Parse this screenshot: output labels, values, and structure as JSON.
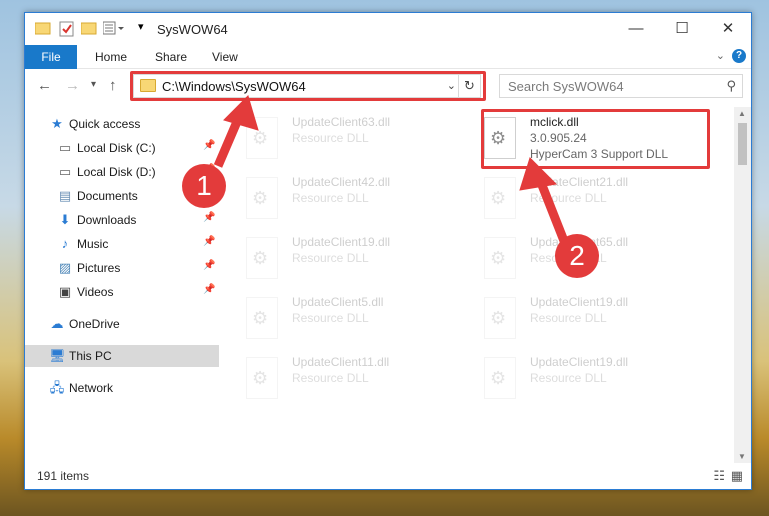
{
  "window": {
    "title": "SysWOW64",
    "controls": {
      "minimize": "—",
      "maximize": "☐",
      "close": "✕"
    }
  },
  "ribbon": {
    "tabs": [
      "File",
      "Home",
      "Share",
      "View"
    ],
    "help": "?"
  },
  "address": {
    "path": "C:\\Windows\\SysWOW64",
    "search_placeholder": "Search SysWOW64"
  },
  "sidebar": {
    "items": [
      {
        "label": "Quick access",
        "icon": "star-icon",
        "pinned": false
      },
      {
        "label": "Local Disk (C:)",
        "icon": "drive-icon",
        "pinned": true
      },
      {
        "label": "Local Disk (D:)",
        "icon": "drive-icon",
        "pinned": true
      },
      {
        "label": "Documents",
        "icon": "documents-icon",
        "pinned": true
      },
      {
        "label": "Downloads",
        "icon": "downloads-icon",
        "pinned": true
      },
      {
        "label": "Music",
        "icon": "music-icon",
        "pinned": true
      },
      {
        "label": "Pictures",
        "icon": "pictures-icon",
        "pinned": true
      },
      {
        "label": "Videos",
        "icon": "videos-icon",
        "pinned": true
      },
      {
        "label": "OneDrive",
        "icon": "cloud-icon",
        "pinned": false
      },
      {
        "label": "This PC",
        "icon": "computer-icon",
        "pinned": false
      },
      {
        "label": "Network",
        "icon": "network-icon",
        "pinned": false
      }
    ]
  },
  "files": [
    {
      "name": "UpdateClient63.dll",
      "desc": "Resource DLL"
    },
    {
      "name": "mclick.dll",
      "desc": "3.0.905.24",
      "extra": "HyperCam 3 Support DLL"
    },
    {
      "name": "UpdateClient42.dll",
      "desc": "Resource DLL"
    },
    {
      "name": "UpdateClient21.dll",
      "desc": "Resource DLL"
    },
    {
      "name": "UpdateClient19.dll",
      "desc": "Resource DLL"
    },
    {
      "name": "UpdateClient65.dll",
      "desc": "Resource DLL"
    },
    {
      "name": "UpdateClient5.dll",
      "desc": "Resource DLL"
    },
    {
      "name": "UpdateClient19.dll",
      "desc": "Resource DLL"
    },
    {
      "name": "UpdateClient11.dll",
      "desc": "Resource DLL"
    },
    {
      "name": "UpdateClient19.dll",
      "desc": "Resource DLL"
    }
  ],
  "status": {
    "count": "191 items"
  },
  "annotations": {
    "step1": "1",
    "step2": "2",
    "color": "#e33b3b"
  }
}
